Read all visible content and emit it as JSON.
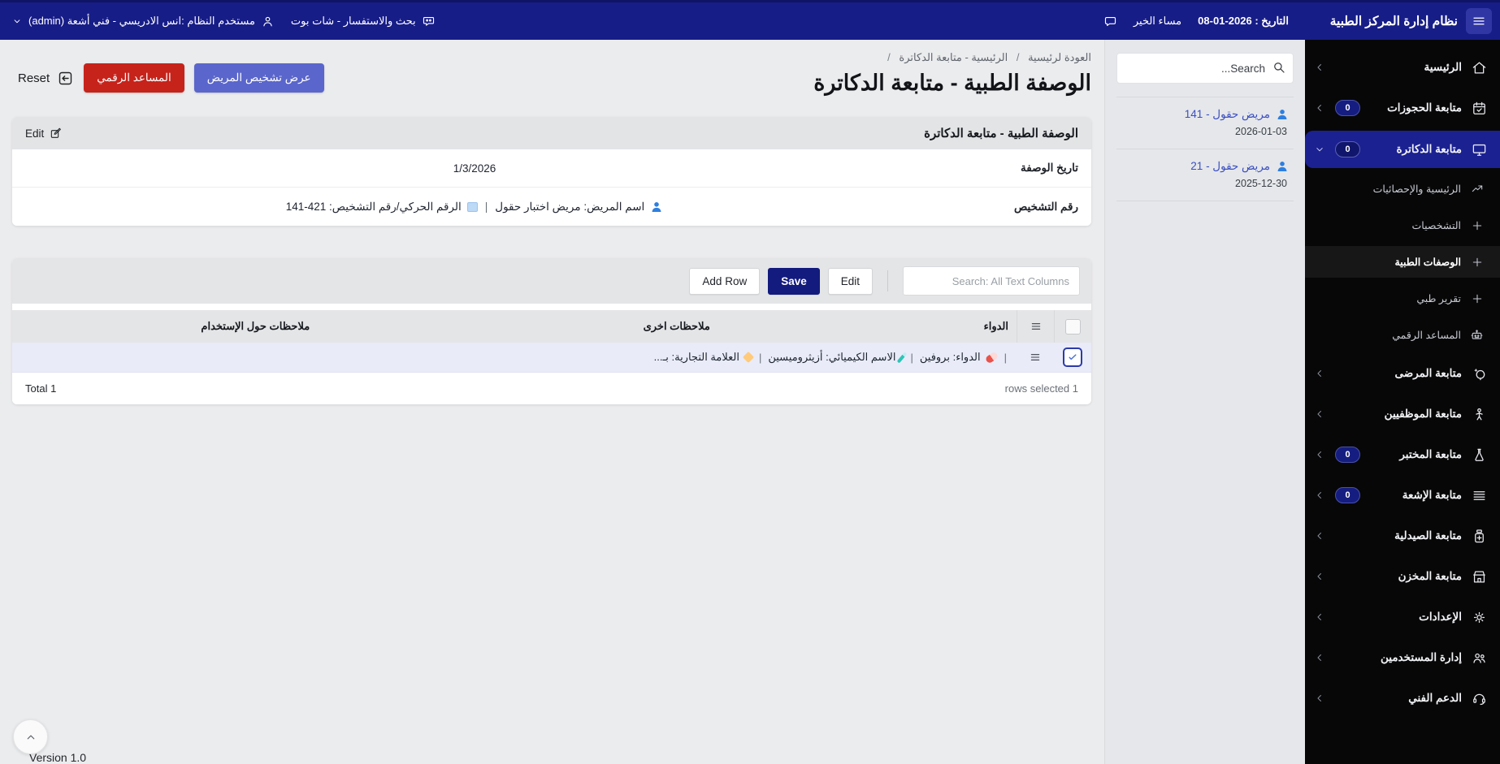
{
  "topbar": {
    "brand_title": "نظام إدارة المركز الطبية",
    "date_label": "التاريخ : 2026-01-08",
    "greeting": "مساء الخير",
    "chatbot_label": "بحث والاستفسار - شات بوت",
    "user_label": "مستخدم النظام :انس الادريسي - فني أشعة (admin)"
  },
  "sidebar": {
    "items": [
      {
        "label": "الرئيسية",
        "icon": "home-icon",
        "chevron": "left",
        "type": "main"
      },
      {
        "label": "متابعة الحجوزات",
        "icon": "calendar-icon",
        "badge": "0",
        "chevron": "left",
        "type": "main"
      },
      {
        "label": "متابعة الدكاترة",
        "icon": "monitor-icon",
        "badge": "0",
        "chevron": "down",
        "type": "main",
        "active": true
      },
      {
        "label": "الرئيسية والإحصائيات",
        "icon": "stats-icon",
        "type": "sub"
      },
      {
        "label": "التشخصيات",
        "icon": "plus-icon",
        "type": "sub"
      },
      {
        "label": "الوصفات الطبية",
        "icon": "plus-icon",
        "type": "sub",
        "active": true
      },
      {
        "label": "تقرير طبي",
        "icon": "plus-icon",
        "type": "sub"
      },
      {
        "label": "المساعد الرقمي",
        "icon": "robot-icon",
        "type": "sub"
      },
      {
        "label": "متابعة المرضى",
        "icon": "patients-icon",
        "chevron": "left",
        "type": "main"
      },
      {
        "label": "متابعة الموظفيين",
        "icon": "staff-icon",
        "chevron": "left",
        "type": "main"
      },
      {
        "label": "متابعة المختبر",
        "icon": "lab-icon",
        "badge": "0",
        "chevron": "left",
        "type": "main"
      },
      {
        "label": "متابعة الإشعة",
        "icon": "radiology-icon",
        "badge": "0",
        "chevron": "left",
        "type": "main"
      },
      {
        "label": "متابعة الصيدلية",
        "icon": "pharmacy-icon",
        "chevron": "left",
        "type": "main"
      },
      {
        "label": "متابعة المخزن",
        "icon": "store-icon",
        "chevron": "left",
        "type": "main"
      },
      {
        "label": "الإعدادات",
        "icon": "gear-icon",
        "chevron": "left",
        "type": "main"
      },
      {
        "label": "إدارة المستخدمين",
        "icon": "users-icon",
        "chevron": "left",
        "type": "main"
      },
      {
        "label": "الدعم الفني",
        "icon": "support-icon",
        "chevron": "left",
        "type": "main"
      }
    ]
  },
  "page": {
    "breadcrumb": [
      "العودة لرئيسية",
      "الرئيسية - متابعة الدكاترة"
    ],
    "breadcrumb_separator": "/",
    "title": "الوصفة الطبية - متابعة الدكاترة",
    "actions": {
      "view_diagnosis": "عرض تشخيص المريض",
      "digital_assistant": "المساعد الرقمي",
      "reset": "Reset"
    }
  },
  "prescription_card": {
    "header": "الوصفة الطبية - متابعة الدكاترة",
    "edit_label": "Edit",
    "fields": {
      "date_label": "تاريخ الوصفة",
      "date_value": "1/3/2026",
      "diagnosis_label": "رقم التشخيص",
      "patient_part": "اسم المريض: مريض اختبار حقول",
      "separator": "|",
      "number_part": "الرقم الحركي/رقم التشخيص: 421-141"
    }
  },
  "grid": {
    "toolbar": {
      "add_row": "Add Row",
      "save": "Save",
      "edit": "Edit",
      "search_placeholder": "Search: All Text Columns"
    },
    "columns": {
      "drug": "الدواء",
      "other_notes": "ملاحظات اخرى",
      "usage_notes": "ملاحظات حول الإستخدام"
    },
    "row": {
      "separator": "|",
      "segments": [
        {
          "icon": "pill-icon",
          "text": "الدواء: بروفين"
        },
        {
          "icon": "test-tube-icon",
          "text": "الاسم الكيميائي: أزيثروميسين"
        },
        {
          "icon": "tag-icon",
          "text": "العلامة التجارية: بـ..."
        }
      ],
      "selected": true
    },
    "footer": {
      "total": "Total 1",
      "rows_selected": "1 rows selected"
    }
  },
  "patients_panel": {
    "search_placeholder": "Search...",
    "items": [
      {
        "name": "مريض حقول - 141",
        "date": "2026-01-03"
      },
      {
        "name": "مريض حقول - 21",
        "date": "2025-12-30"
      }
    ]
  },
  "footer": {
    "version": "Version 1.0"
  },
  "colors": {
    "topbar_navy": "#171d87",
    "active_nav_navy": "#1b2191",
    "save_navy": "#131b7e",
    "action_indigo": "#5a66cb",
    "action_red": "#c6231b",
    "patient_link": "#3b4fc0",
    "person_icon_blue": "#2d7fe0",
    "selected_row": "#e9ebf8",
    "sidebar_black": "#070708"
  }
}
